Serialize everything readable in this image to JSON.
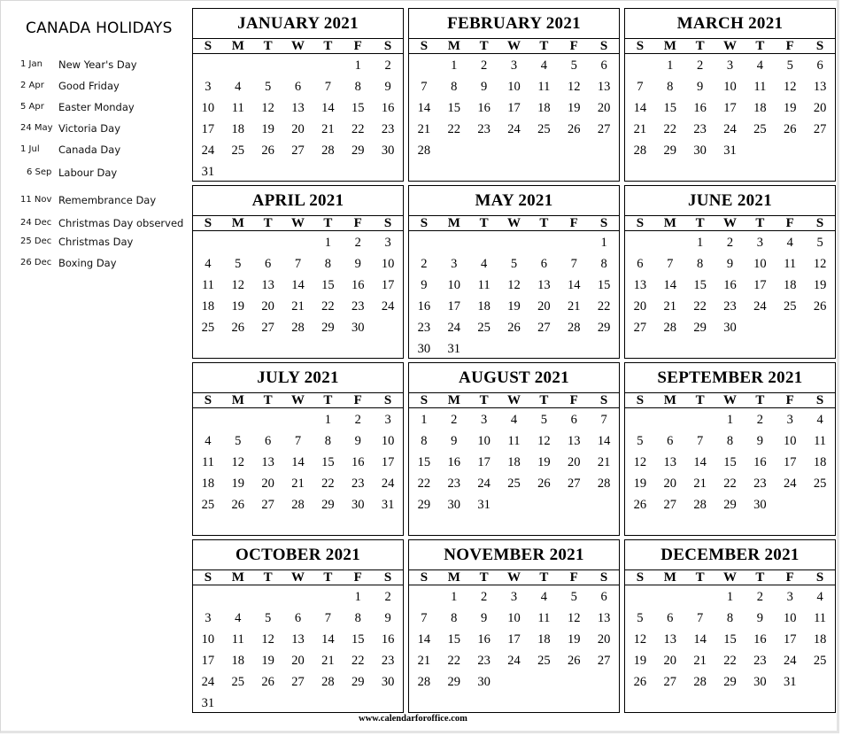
{
  "sidebar": {
    "title": "CANADA HOLIDAYS",
    "holidays": [
      {
        "date": "1 Jan",
        "name": "New Year's Day"
      },
      {
        "date": "2 Apr",
        "name": "Good Friday"
      },
      {
        "date": "5 Apr",
        "name": "Easter Monday"
      },
      {
        "date": "24 May",
        "name": "Victoria Day"
      },
      {
        "date": "1 Jul",
        "name": "Canada Day"
      },
      {
        "date": "6 Sep",
        "name": "Labour Day"
      },
      {
        "date": "11 Nov",
        "name": "Remembrance Day"
      },
      {
        "date": "24 Dec",
        "name": "Christmas Day observed"
      },
      {
        "date": "25 Dec",
        "name": "Christmas Day"
      },
      {
        "date": "26 Dec",
        "name": "Boxing Day"
      }
    ]
  },
  "weekdays": [
    "S",
    "M",
    "T",
    "W",
    "T",
    "F",
    "S"
  ],
  "months": [
    {
      "title": "JANUARY 2021",
      "start": 5,
      "days": 31
    },
    {
      "title": "FEBRUARY 2021",
      "start": 1,
      "days": 28
    },
    {
      "title": "MARCH 2021",
      "start": 1,
      "days": 31
    },
    {
      "title": "APRIL 2021",
      "start": 4,
      "days": 30
    },
    {
      "title": "MAY 2021",
      "start": 6,
      "days": 31
    },
    {
      "title": "JUNE 2021",
      "start": 2,
      "days": 30
    },
    {
      "title": "JULY 2021",
      "start": 4,
      "days": 31
    },
    {
      "title": "AUGUST 2021",
      "start": 0,
      "days": 31
    },
    {
      "title": "SEPTEMBER 2021",
      "start": 3,
      "days": 30
    },
    {
      "title": "OCTOBER 2021",
      "start": 5,
      "days": 31
    },
    {
      "title": "NOVEMBER 2021",
      "start": 1,
      "days": 30
    },
    {
      "title": "DECEMBER 2021",
      "start": 3,
      "days": 31
    }
  ],
  "footer": "www.calendarforoffice.com"
}
